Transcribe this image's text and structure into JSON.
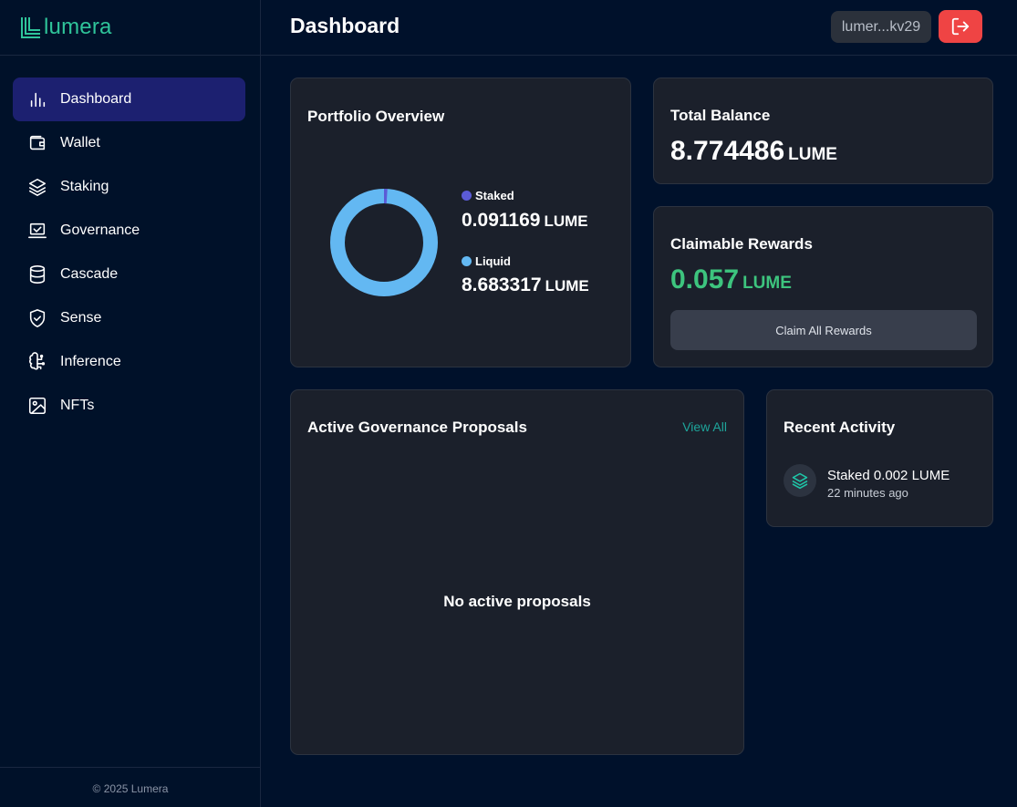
{
  "app": {
    "logo_text": "lumera",
    "footer": "© 2025 Lumera"
  },
  "colors": {
    "background": "#00112b",
    "card": "#1b202b",
    "active_nav": "#1c2070",
    "accent_green": "#3dc47e",
    "accent_teal": "#1ea59b",
    "logout_red": "#ef4444",
    "staked": "#5b5bd6",
    "liquid": "#63b8f2"
  },
  "sidebar": {
    "items": [
      {
        "label": "Dashboard",
        "icon": "bar-chart-icon",
        "active": true
      },
      {
        "label": "Wallet",
        "icon": "wallet-icon",
        "active": false
      },
      {
        "label": "Staking",
        "icon": "layers-icon",
        "active": false
      },
      {
        "label": "Governance",
        "icon": "vote-icon",
        "active": false
      },
      {
        "label": "Cascade",
        "icon": "database-icon",
        "active": false
      },
      {
        "label": "Sense",
        "icon": "shield-check-icon",
        "active": false
      },
      {
        "label": "Inference",
        "icon": "brain-icon",
        "active": false
      },
      {
        "label": "NFTs",
        "icon": "image-icon",
        "active": false
      }
    ]
  },
  "header": {
    "title": "Dashboard",
    "address": "lumer...kv29",
    "logout_icon": "logout-icon"
  },
  "portfolio": {
    "title": "Portfolio Overview",
    "staked_label": "Staked",
    "staked_value": "0.091169",
    "liquid_label": "Liquid",
    "liquid_value": "8.683317",
    "unit": "LUME",
    "staked_fraction": 0.0104
  },
  "total_balance": {
    "title": "Total Balance",
    "value": "8.774486",
    "unit": "LUME"
  },
  "rewards": {
    "title": "Claimable Rewards",
    "value": "0.057",
    "unit": "LUME",
    "button": "Claim All Rewards"
  },
  "governance": {
    "title": "Active Governance Proposals",
    "view_all": "View All",
    "empty": "No active proposals"
  },
  "activity": {
    "title": "Recent Activity",
    "items": [
      {
        "title": "Staked 0.002 LUME",
        "time": "22 minutes ago",
        "icon": "layers-icon"
      }
    ]
  }
}
